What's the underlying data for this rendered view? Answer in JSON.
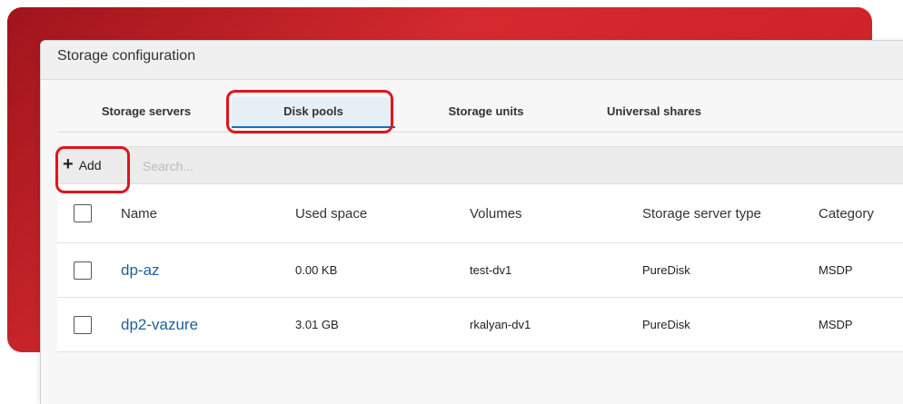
{
  "window": {
    "title": "Storage configuration"
  },
  "tabs": [
    {
      "label": "Storage servers"
    },
    {
      "label": "Disk pools",
      "active": true
    },
    {
      "label": "Storage units"
    },
    {
      "label": "Universal shares"
    }
  ],
  "toolbar": {
    "add_label": "Add",
    "search_placeholder": "Search..."
  },
  "table": {
    "headers": [
      "Name",
      "Used space",
      "Volumes",
      "Storage server type",
      "Category"
    ],
    "rows": [
      {
        "name": "dp-az",
        "used": "0.00 KB",
        "volumes": "test-dv1",
        "type": "PureDisk",
        "category": "MSDP"
      },
      {
        "name": "dp2-vazure",
        "used": "3.01 GB",
        "volumes": "rkalyan-dv1",
        "type": "PureDisk",
        "category": "MSDP"
      }
    ]
  },
  "colors": {
    "accent_red": "#e0141e",
    "link_blue": "#1f5f9e",
    "tab_active_bg": "#e6eef6",
    "background_red": "#c81e24"
  }
}
